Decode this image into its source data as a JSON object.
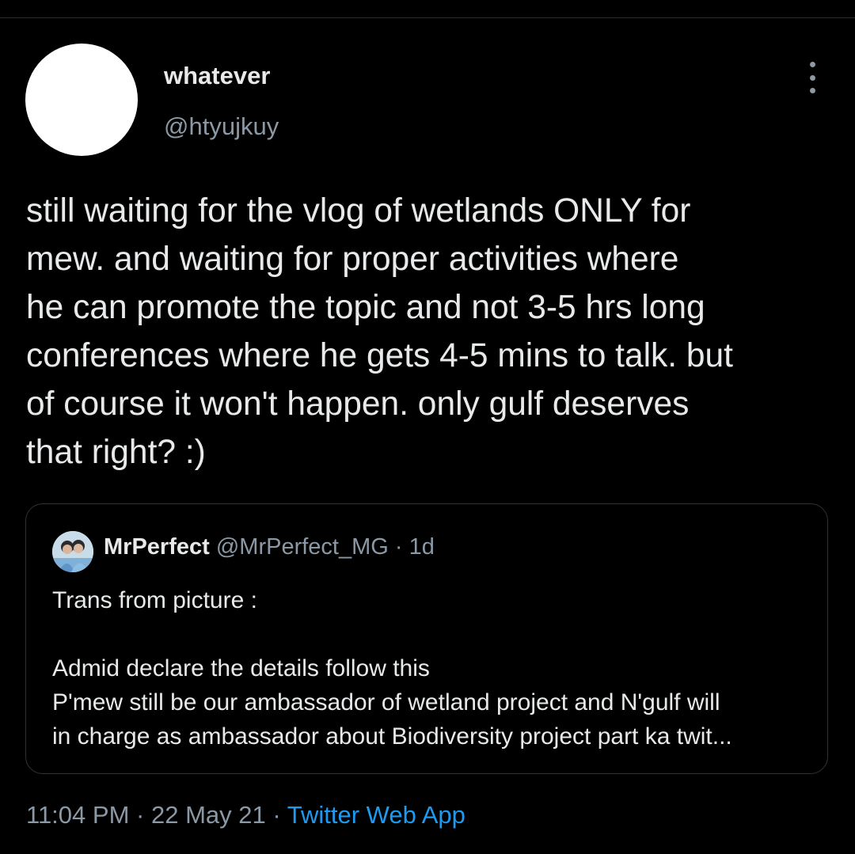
{
  "tweet": {
    "author": {
      "name": "whatever",
      "handle": "@htyujkuy"
    },
    "more_icon": "more-vertical-icon",
    "text_lines": [
      "still waiting for the vlog of wetlands ONLY for",
      "mew. and waiting for proper activities where",
      "he can promote the topic and not 3-5 hrs long",
      "conferences where he gets 4-5 mins to talk. but",
      "of course it won't happen. only gulf deserves",
      "that right? :)"
    ],
    "quoted": {
      "name": "MrPerfect",
      "handle": "@MrPerfect_MG",
      "separator": "·",
      "time": "1d",
      "body_lines": [
        "Trans from picture :",
        "",
        "Admid declare the details follow this",
        "P'mew still be our ambassador of wetland project and N'gulf will",
        "in charge as ambassador about Biodiversity project part ka twit..."
      ]
    },
    "meta": {
      "time": "11:04 PM",
      "separator": "·",
      "date": "22 May 21",
      "source": "Twitter Web App"
    }
  },
  "colors": {
    "background": "#000000",
    "text": "#e7e9ea",
    "secondary_text": "#8b98a5",
    "link": "#1d9bf0",
    "border": "#2f3336"
  }
}
